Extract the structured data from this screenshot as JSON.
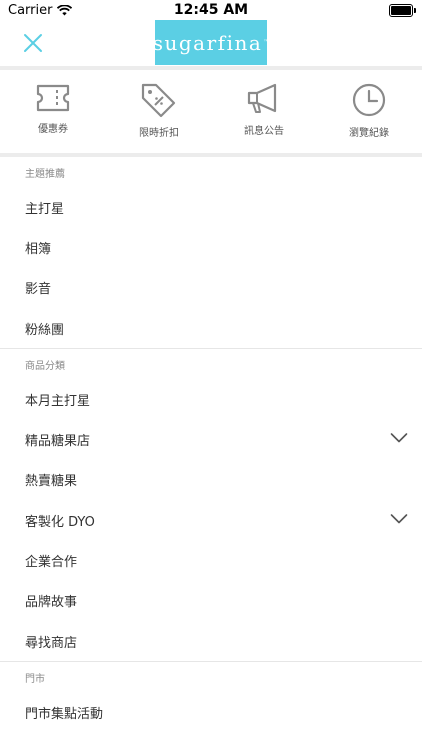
{
  "status_bar": {
    "carrier": "Carrier",
    "time": "12:45 AM"
  },
  "header": {
    "logo_text": "sugarfina",
    "logo_mark": "™"
  },
  "colors": {
    "brand": "#5bcfe4",
    "icon_gray": "#8a8a8a"
  },
  "quick_actions": [
    {
      "label": "優惠券",
      "icon": "ticket-icon"
    },
    {
      "label": "限時折扣",
      "icon": "discount-tag-icon"
    },
    {
      "label": "訊息公告",
      "icon": "megaphone-icon"
    },
    {
      "label": "瀏覽紀錄",
      "icon": "clock-icon"
    }
  ],
  "sections": [
    {
      "title": "主題推薦",
      "items": [
        {
          "label": "主打星"
        },
        {
          "label": "相簿"
        },
        {
          "label": "影音"
        },
        {
          "label": "粉絲團"
        }
      ]
    },
    {
      "title": "商品分類",
      "items": [
        {
          "label": "本月主打星"
        },
        {
          "label": "精品糖果店",
          "expandable": true
        },
        {
          "label": "熱賣糖果"
        },
        {
          "label": "客製化 DYO",
          "expandable": true
        },
        {
          "label": "企業合作"
        },
        {
          "label": "品牌故事"
        },
        {
          "label": "尋找商店"
        }
      ]
    },
    {
      "title": "門市",
      "items": [
        {
          "label": "門市集點活動"
        }
      ]
    }
  ]
}
